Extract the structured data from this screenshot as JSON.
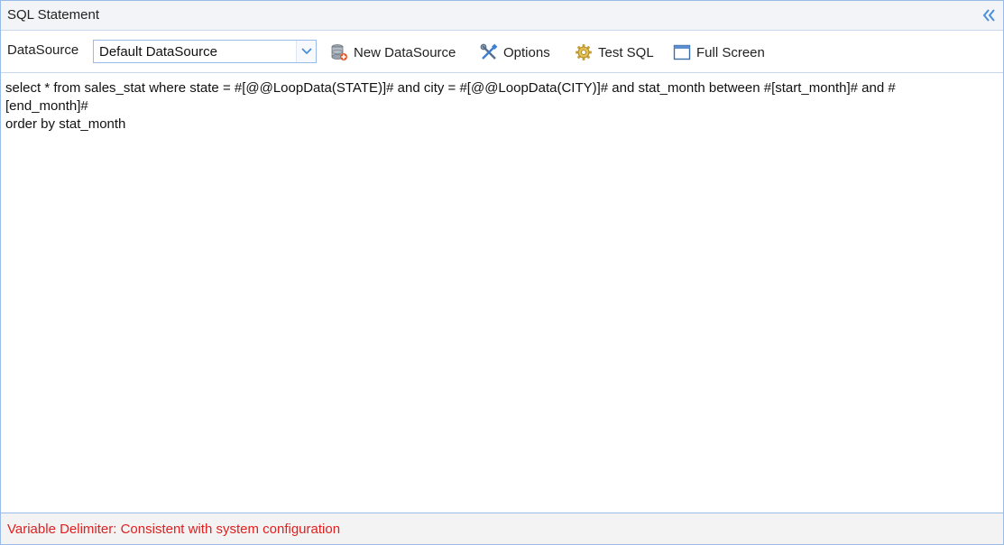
{
  "panel": {
    "title": "SQL Statement",
    "collapse_icon": "double-chevron-left-icon"
  },
  "toolbar": {
    "datasource_label": "DataSource",
    "datasource_value": "Default DataSource",
    "new_datasource_label": "New DataSource",
    "options_label": "Options",
    "test_sql_label": "Test SQL",
    "full_screen_label": "Full Screen"
  },
  "editor": {
    "lines": [
      "select * from sales_stat where state = #[@@LoopData(STATE)]# and city = #[@@LoopData(CITY)]# and stat_month between #[start_month]# and #",
      "[end_month]#",
      "order by stat_month"
    ]
  },
  "footer": {
    "note": "Variable Delimiter: Consistent with system configuration"
  },
  "colors": {
    "accent": "#99bbe8",
    "footer_text": "#e02020"
  }
}
